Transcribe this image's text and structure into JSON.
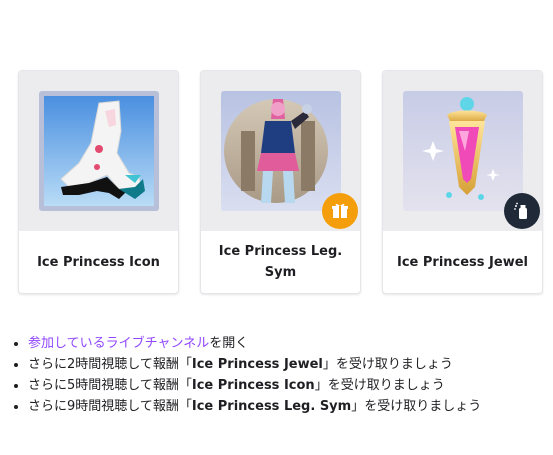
{
  "rewards": [
    {
      "title": "Ice Princess Icon",
      "image_icon": "shoe-icon"
    },
    {
      "title": "Ice Princess Leg. Sym",
      "image_icon": "character-portrait",
      "badge_icon": "gift-icon",
      "badge_color": "#f59e0b"
    },
    {
      "title": "Ice Princess Jewel",
      "image_icon": "jewel-charm-icon",
      "badge_icon": "spray-icon",
      "badge_color": "#1f2937"
    }
  ],
  "instructions": {
    "step1": {
      "link_text": "参加しているライブチャンネル",
      "suffix": "を開く"
    },
    "step2": {
      "prefix": "さらに2時間視聴して報酬「",
      "reward": "Ice Princess Jewel",
      "suffix": "」を受け取りましょう"
    },
    "step3": {
      "prefix": "さらに5時間視聴して報酬「",
      "reward": "Ice Princess Icon",
      "suffix": "」を受け取りましょう"
    },
    "step4": {
      "prefix": "さらに9時間視聴して報酬「",
      "reward": "Ice Princess Leg. Sym",
      "suffix": "」を受け取りましょう"
    }
  },
  "colors": {
    "link": "#9147ff",
    "card_bg": "#ececef"
  }
}
